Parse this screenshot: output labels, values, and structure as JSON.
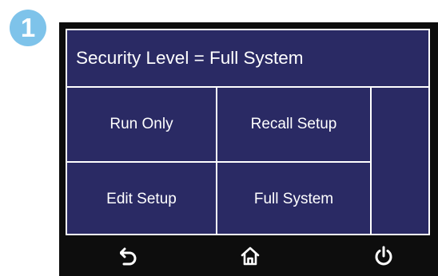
{
  "step": {
    "number": "1"
  },
  "screen": {
    "title": "Security Level = Full System",
    "options": {
      "run_only": "Run Only",
      "recall_setup": "Recall Setup",
      "edit_setup": "Edit Setup",
      "full_system": "Full System"
    }
  },
  "nav": {
    "back_icon": "back-arrow-icon",
    "home_icon": "home-icon",
    "power_icon": "power-icon"
  },
  "colors": {
    "screen_bg": "#2a2a64",
    "bezel": "#0d0d0d",
    "badge": "#7ec3ea",
    "text": "#ffffff"
  }
}
